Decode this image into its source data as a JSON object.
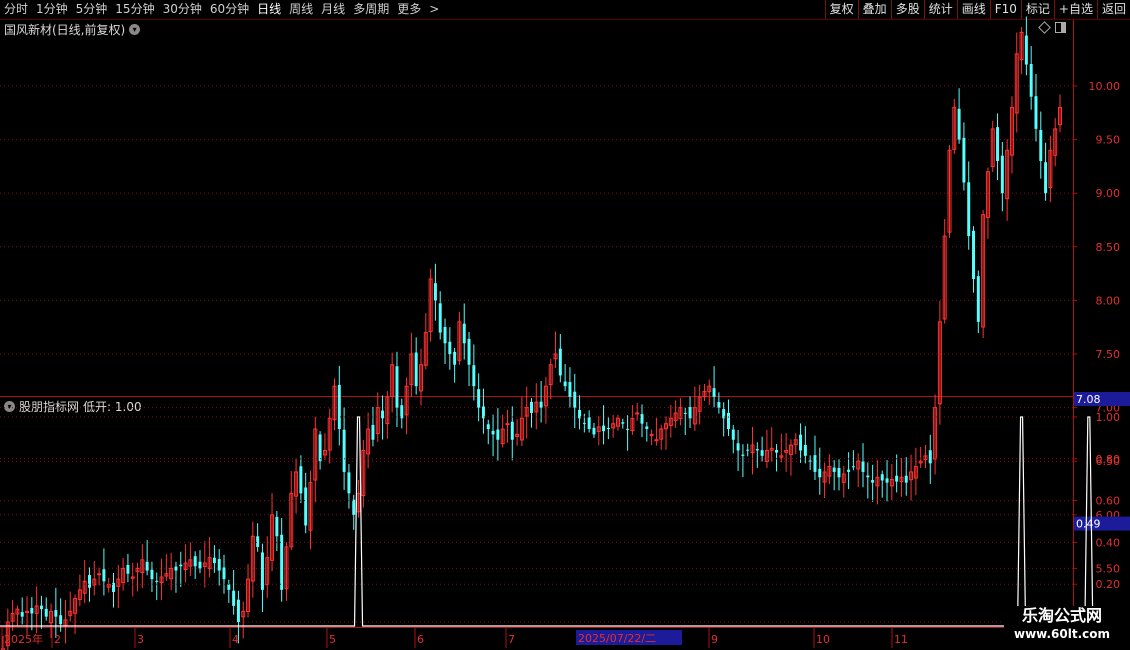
{
  "toolbar": {
    "periods": [
      "分时",
      "1分钟",
      "5分钟",
      "15分钟",
      "30分钟",
      "60分钟",
      "日线",
      "周线",
      "月线",
      "多周期",
      "更多"
    ],
    "active_period": "日线",
    "more_arrow": ">",
    "tools": [
      "复权",
      "叠加",
      "多股",
      "统计",
      "画线",
      "F10",
      "标记",
      "+自选",
      "返回"
    ]
  },
  "main_chart": {
    "title": "国风新材(日线,前复权)",
    "current_price": "7.08",
    "y_ticks": [
      "5.00",
      "5.50",
      "6.00",
      "6.50",
      "7.00",
      "7.50",
      "8.00",
      "8.50",
      "9.00",
      "9.50",
      "10.00"
    ]
  },
  "indicator": {
    "name": "股朋指标网",
    "label": "低开: 1.00",
    "current_value": "0.49",
    "y_ticks": [
      "0.20",
      "0.40",
      "0.60",
      "0.80",
      "1.00"
    ]
  },
  "date_axis": {
    "labels": [
      "2025年",
      "2",
      "3",
      "4",
      "5",
      "6",
      "7",
      "9",
      "10",
      "11"
    ],
    "cursor_date": "2025/07/22/二"
  },
  "watermark": {
    "title": "乐淘公式网",
    "url": "www.60lt.com"
  },
  "colors": {
    "up": "#ff3232",
    "down": "#54ffff",
    "grid": "#7a1010",
    "axis": "#b01010",
    "signal": "#ffffff"
  },
  "chart_data": [
    {
      "type": "candlestick",
      "title": "国风新材(日线,前复权)",
      "ylim": [
        4.5,
        10.6
      ],
      "series": [
        {
          "name": "国风新材",
          "close": [
            4.75,
            5.0,
            5.08,
            5.12,
            5.05,
            5.1,
            5.08,
            5.15,
            5.12,
            5.05,
            5.1,
            5.05,
            4.98,
            5.02,
            5.1,
            5.22,
            5.3,
            5.38,
            5.32,
            5.4,
            5.45,
            5.38,
            5.35,
            5.28,
            5.4,
            5.5,
            5.45,
            5.42,
            5.5,
            5.58,
            5.48,
            5.4,
            5.38,
            5.42,
            5.45,
            5.5,
            5.48,
            5.52,
            5.55,
            5.58,
            5.52,
            5.5,
            5.55,
            5.6,
            5.55,
            5.48,
            5.4,
            5.3,
            5.15,
            5.0,
            5.1,
            5.4,
            5.8,
            5.7,
            5.3,
            5.6,
            6.0,
            5.8,
            5.3,
            5.7,
            6.2,
            6.4,
            6.2,
            5.9,
            6.3,
            6.8,
            6.5,
            6.6,
            6.9,
            7.2,
            6.8,
            6.4,
            6.2,
            6.0,
            6.2,
            6.6,
            6.8,
            6.7,
            7.0,
            6.9,
            7.1,
            7.4,
            7.0,
            6.9,
            7.2,
            7.5,
            7.2,
            7.4,
            7.7,
            8.2,
            8.0,
            7.7,
            7.6,
            7.5,
            7.4,
            7.8,
            7.6,
            7.4,
            7.2,
            7.0,
            6.9,
            6.8,
            6.75,
            6.7,
            6.8,
            6.85,
            6.7,
            6.75,
            6.9,
            7.0,
            6.95,
            7.05,
            7.0,
            7.2,
            7.4,
            7.5,
            7.3,
            7.2,
            7.1,
            7.0,
            6.9,
            6.85,
            6.8,
            6.75,
            6.82,
            6.78,
            6.8,
            6.85,
            6.9,
            6.85,
            6.8,
            6.9,
            6.95,
            6.85,
            6.8,
            6.75,
            6.7,
            6.8,
            6.85,
            6.9,
            6.95,
            7.0,
            6.95,
            6.9,
            7.0,
            7.1,
            7.15,
            7.2,
            7.1,
            7.0,
            6.9,
            6.8,
            6.7,
            6.6,
            6.55,
            6.6,
            6.65,
            6.6,
            6.55,
            6.6,
            6.62,
            6.58,
            6.55,
            6.6,
            6.65,
            6.7,
            6.6,
            6.55,
            6.5,
            6.4,
            6.35,
            6.4,
            6.45,
            6.4,
            6.35,
            6.38,
            6.4,
            6.45,
            6.5,
            6.4,
            6.35,
            6.3,
            6.35,
            6.32,
            6.3,
            6.33,
            6.31,
            6.35,
            6.3,
            6.4,
            6.45,
            6.5,
            6.55,
            6.48,
            7.0,
            7.8,
            8.6,
            9.4,
            9.8,
            9.5,
            9.1,
            8.6,
            8.2,
            7.8,
            8.8,
            9.2,
            9.6,
            9.3,
            9.0,
            9.4,
            9.8,
            10.3,
            10.5,
            10.2,
            9.9,
            9.6,
            9.3,
            9.0,
            9.4,
            9.6,
            9.8
          ]
        }
      ]
    },
    {
      "type": "line",
      "title": "低开",
      "ylim": [
        0,
        1.1
      ],
      "series": [
        {
          "name": "低开",
          "spikes_at_index": [
            74,
            212,
            226
          ],
          "values": "0 everywhere except 1.00 at spikes_at_index"
        }
      ]
    }
  ]
}
